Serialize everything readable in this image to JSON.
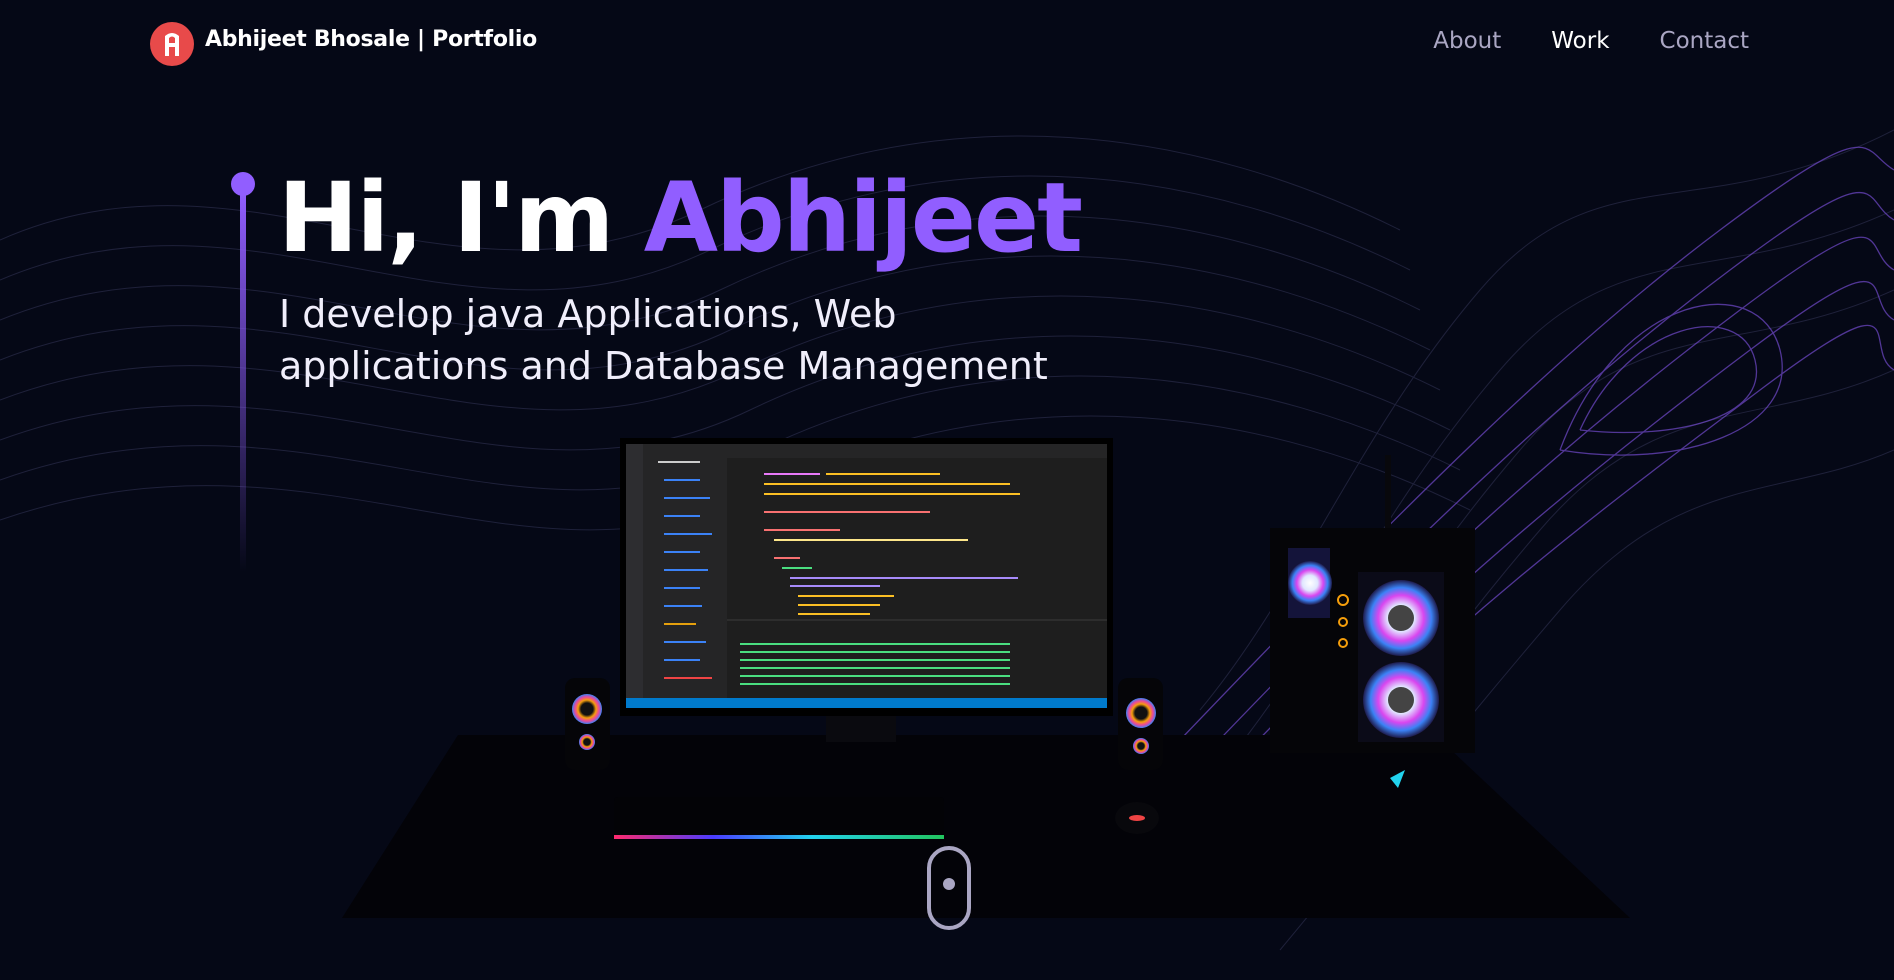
{
  "nav": {
    "brand": "Abhijeet Bhosale | Portfolio",
    "links": [
      {
        "label": "About"
      },
      {
        "label": "Work"
      },
      {
        "label": "Contact"
      }
    ]
  },
  "hero": {
    "greeting": "Hi, I'm ",
    "name": "Abhijeet",
    "subtitle": "I develop java Applications, Web applications and Database Management"
  },
  "colors": {
    "background": "#050816",
    "accent": "#915eff",
    "secondary_text": "#aaa6c3",
    "logo": "#e84a4a"
  },
  "icons": {
    "logo": "logo-icon",
    "scroll": "mouse-scroll-icon"
  }
}
